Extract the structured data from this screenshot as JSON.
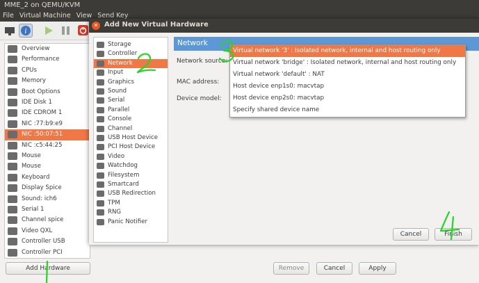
{
  "window": {
    "title": "MME_2 on QEMU/KVM"
  },
  "menu": [
    "File",
    "Virtual Machine",
    "View",
    "Send Key"
  ],
  "toolbar": {
    "icons": [
      "monitor-icon",
      "info-icon",
      "run-icon",
      "pause-icon",
      "power-icon"
    ]
  },
  "hardware": {
    "items": [
      {
        "label": "Overview",
        "icon": "overview-icon"
      },
      {
        "label": "Performance",
        "icon": "performance-icon"
      },
      {
        "label": "CPUs",
        "icon": "cpu-icon"
      },
      {
        "label": "Memory",
        "icon": "memory-icon"
      },
      {
        "label": "Boot Options",
        "icon": "boot-icon"
      },
      {
        "label": "IDE Disk 1",
        "icon": "disk-icon"
      },
      {
        "label": "IDE CDROM 1",
        "icon": "cdrom-icon"
      },
      {
        "label": "NIC :77:b9:e9",
        "icon": "nic-icon"
      },
      {
        "label": "NIC :50:07:51",
        "icon": "nic-icon",
        "selected": true
      },
      {
        "label": "NIC :c5:44:25",
        "icon": "nic-icon"
      },
      {
        "label": "Mouse",
        "icon": "mouse-icon"
      },
      {
        "label": "Mouse",
        "icon": "mouse-icon"
      },
      {
        "label": "Keyboard",
        "icon": "keyboard-icon"
      },
      {
        "label": "Display Spice",
        "icon": "display-icon"
      },
      {
        "label": "Sound: ich6",
        "icon": "sound-icon"
      },
      {
        "label": "Serial 1",
        "icon": "serial-icon"
      },
      {
        "label": "Channel spice",
        "icon": "channel-icon"
      },
      {
        "label": "Video QXL",
        "icon": "video-icon"
      },
      {
        "label": "Controller USB",
        "icon": "controller-icon"
      },
      {
        "label": "Controller PCI",
        "icon": "controller-icon"
      }
    ],
    "add_button": "Add Hardware",
    "remove_button": "Remove",
    "cancel_button": "Cancel",
    "apply_button": "Apply"
  },
  "dialog": {
    "title": "Add New Virtual Hardware",
    "devices": [
      {
        "label": "Storage"
      },
      {
        "label": "Controller"
      },
      {
        "label": "Network",
        "selected": true
      },
      {
        "label": "Input"
      },
      {
        "label": "Graphics"
      },
      {
        "label": "Sound"
      },
      {
        "label": "Serial"
      },
      {
        "label": "Parallel"
      },
      {
        "label": "Console"
      },
      {
        "label": "Channel"
      },
      {
        "label": "USB Host Device"
      },
      {
        "label": "PCI Host Device"
      },
      {
        "label": "Video"
      },
      {
        "label": "Watchdog"
      },
      {
        "label": "Filesystem"
      },
      {
        "label": "Smartcard"
      },
      {
        "label": "USB Redirection"
      },
      {
        "label": "TPM"
      },
      {
        "label": "RNG"
      },
      {
        "label": "Panic Notifier"
      }
    ],
    "header": "Network",
    "network_source_label": "Network source:",
    "mac_label": "MAC address:",
    "device_model_label": "Device model:",
    "options": [
      {
        "label": "Virtual network '3' : Isolated network, internal and host routing only",
        "selected": true
      },
      {
        "label": "Virtual network 'bridge' : Isolated network, internal and host routing only"
      },
      {
        "label": "Virtual network 'default' : NAT"
      },
      {
        "label": "Host device enp1s0: macvtap"
      },
      {
        "label": "Host device enp2s0: macvtap"
      },
      {
        "label": "Specify shared device name"
      }
    ],
    "cancel_button": "Cancel",
    "finish_button": "Finish"
  },
  "accent_color": "#f07746"
}
